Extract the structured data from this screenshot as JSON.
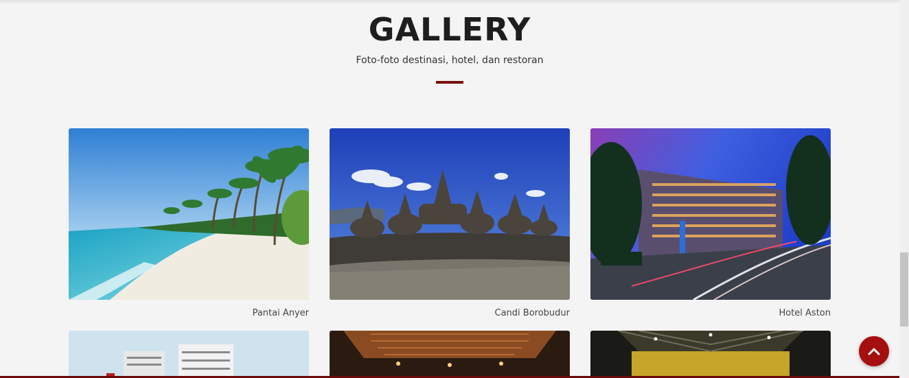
{
  "section": {
    "title": "GALLERY",
    "subtitle": "Foto-foto destinasi, hotel, dan restoran",
    "accent_color": "#7a0a0a"
  },
  "gallery": {
    "items": [
      {
        "caption": "Pantai Anyer"
      },
      {
        "caption": "Candi Borobudur"
      },
      {
        "caption": "Hotel Aston"
      },
      {
        "caption": ""
      },
      {
        "caption": ""
      },
      {
        "caption": ""
      }
    ]
  },
  "back_to_top": {
    "icon": "chevron-up-icon",
    "color": "#a60f0f"
  }
}
